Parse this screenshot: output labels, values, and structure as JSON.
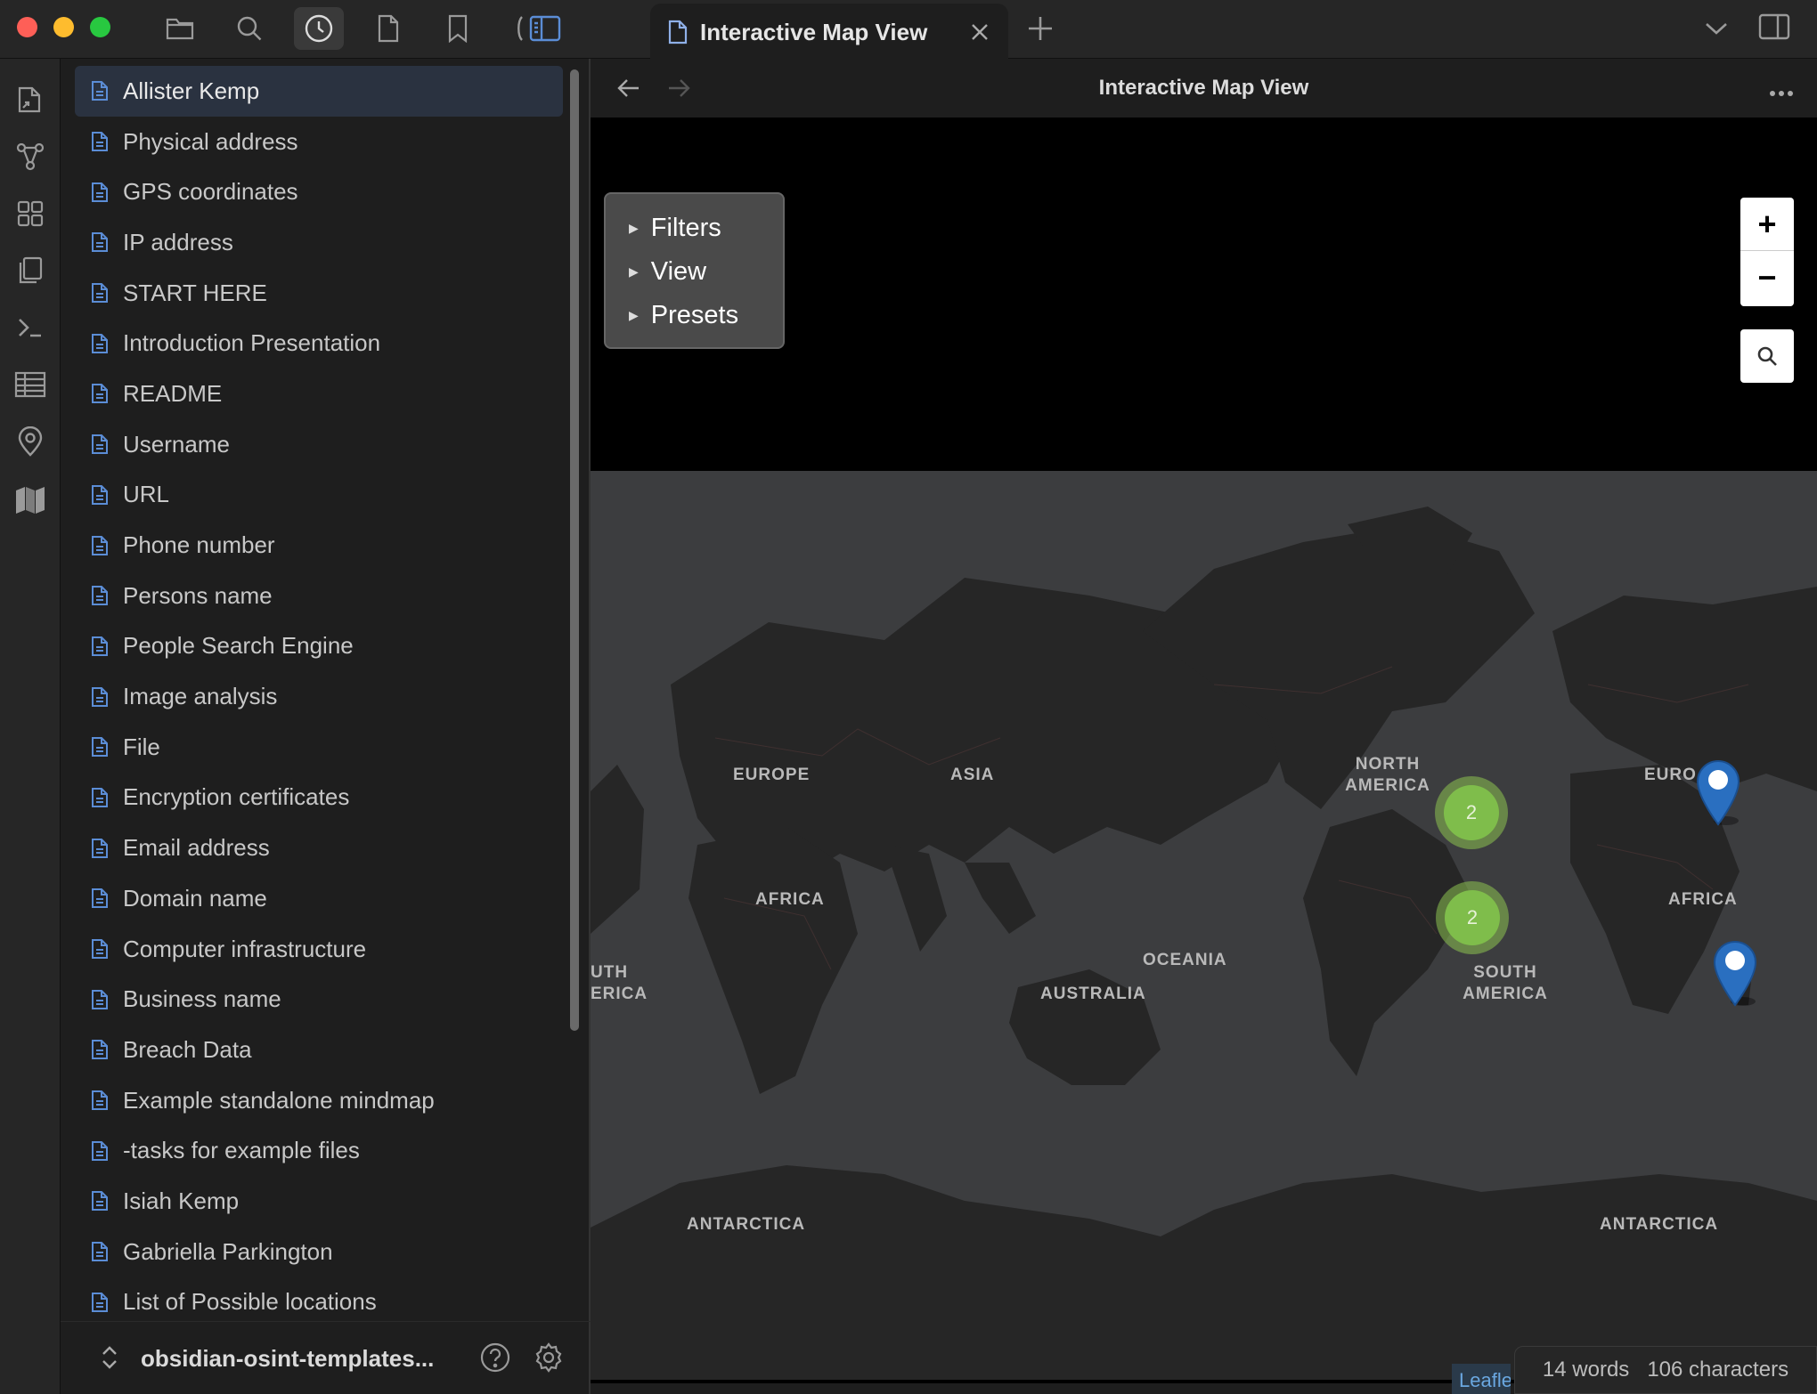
{
  "window": {
    "tab_title": "Interactive Map View",
    "toolbar_icons": [
      "folder-icon",
      "search-icon",
      "recent-files-icon",
      "file-icon",
      "bookmark-icon",
      "sidebar-toggle-icon"
    ]
  },
  "ribbon": {
    "icons": [
      "open-quick-switcher-icon",
      "graph-view-icon",
      "canvas-icon",
      "templates-icon",
      "command-palette-icon",
      "table-icon",
      "map-pin-icon",
      "map-icon"
    ]
  },
  "sidebar": {
    "files": [
      "Allister Kemp",
      "Physical address",
      "GPS coordinates",
      "IP address",
      "START HERE",
      "Introduction Presentation",
      "README",
      "Username",
      "URL",
      "Phone number",
      "Persons name",
      "People Search Engine",
      "Image analysis",
      "File",
      "Encryption certificates",
      "Email address",
      "Domain name",
      "Computer infrastructure",
      "Business name",
      "Breach Data",
      "Example standalone mindmap",
      "-tasks for example files",
      "Isiah Kemp",
      "Gabriella Parkington",
      "List of Possible locations"
    ],
    "selected_index": 0,
    "vault_name": "obsidian-osint-templates..."
  },
  "view": {
    "title": "Interactive Map View"
  },
  "map": {
    "panel": {
      "filters": "Filters",
      "view": "View",
      "presets": "Presets"
    },
    "zoom_in": "+",
    "zoom_out": "−",
    "labels": {
      "europe": "EUROPE",
      "asia": "ASIA",
      "north_america": "NORTH AMERICA",
      "africa": "AFRICA",
      "oceania": "OCEANIA",
      "australia": "AUSTRALIA",
      "south_america": "SOUTH AMERICA",
      "south_america_left": "UTH ERICA",
      "europe_right": "EURO",
      "africa_right": "AFRICA",
      "antarctica": "ANTARCTICA",
      "antarctica_right": "ANTARCTICA"
    },
    "clusters": [
      {
        "count": "2"
      },
      {
        "count": "2"
      }
    ],
    "attribution": "Leaflet"
  },
  "status": {
    "words": "14 words",
    "characters": "106 characters"
  },
  "colors": {
    "accent": "#5b8dd6",
    "background": "#1e1e1e",
    "map_land": "#262626",
    "map_ocean": "#3c3d3f",
    "cluster": "#7fbd4b",
    "marker": "#2a6fc0"
  }
}
